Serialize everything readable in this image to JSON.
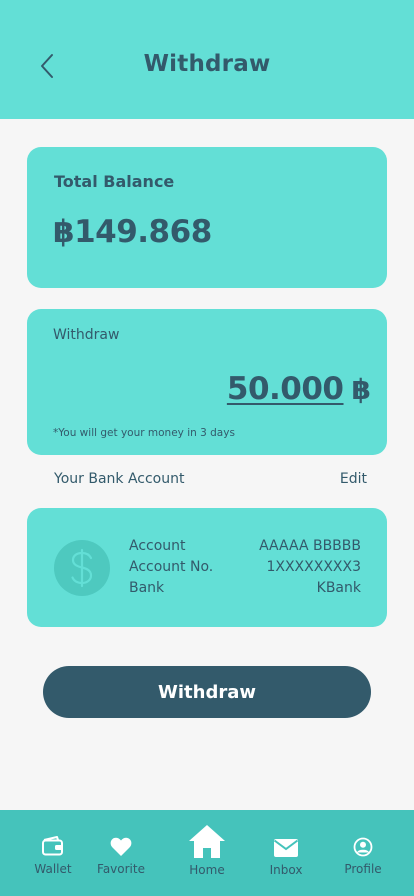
{
  "header": {
    "title": "Withdraw",
    "back_icon": "chevron-left-icon"
  },
  "balance": {
    "label": "Total Balance",
    "value": "฿149.868"
  },
  "withdraw": {
    "label": "Withdraw",
    "amount": "50.000",
    "currency_symbol": "฿",
    "note": "*You will get your money in 3 days"
  },
  "bank": {
    "section_title": "Your Bank Account",
    "edit_label": "Edit",
    "icon": "dollar-icon",
    "rows": [
      {
        "label": "Account",
        "value": "AAAAA BBBBB"
      },
      {
        "label": "Account No.",
        "value": "1XXXXXXXX3"
      },
      {
        "label": "Bank",
        "value": "KBank"
      }
    ]
  },
  "submit": {
    "label": "Withdraw"
  },
  "nav": {
    "items": [
      {
        "label": "Wallet",
        "icon": "wallet-icon"
      },
      {
        "label": "Favorite",
        "icon": "heart-icon"
      },
      {
        "label": "Home",
        "icon": "home-icon"
      },
      {
        "label": "Inbox",
        "icon": "mail-icon"
      },
      {
        "label": "Profile",
        "icon": "profile-icon"
      }
    ]
  },
  "colors": {
    "accent": "#63dfd6",
    "dark": "#335a6b",
    "nav_bg": "#45c3bb",
    "background": "#f6f6f6"
  }
}
